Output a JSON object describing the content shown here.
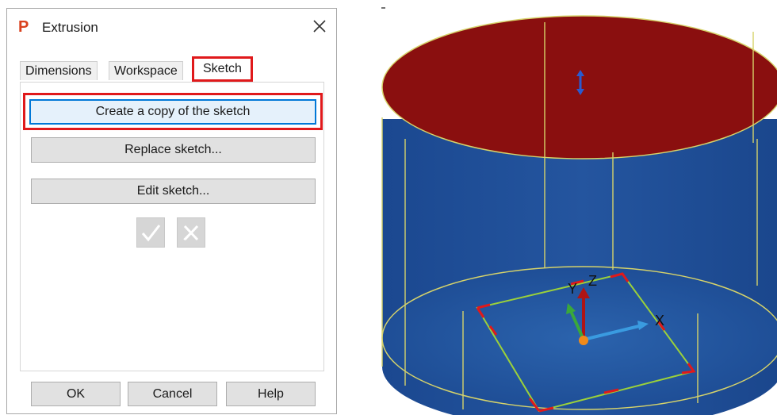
{
  "dialog": {
    "app_icon_letter": "P",
    "title": "Extrusion",
    "tabs": [
      {
        "label": "Dimensions",
        "active": false
      },
      {
        "label": "Workspace",
        "active": false
      },
      {
        "label": "Sketch",
        "active": true
      }
    ],
    "buttons": {
      "create_copy": "Create a copy of the sketch",
      "replace": "Replace sketch...",
      "edit": "Edit sketch...",
      "ok": "OK",
      "cancel": "Cancel",
      "help": "Help"
    }
  },
  "viewport": {
    "axis_labels": {
      "x": "X",
      "y": "Y",
      "z": "Z"
    },
    "colors": {
      "cylinder_side": "#1f4f9b",
      "cylinder_top": "#8c0d0d",
      "edge_lines": "#d6d36a",
      "sketch_frame": "#9bd13a",
      "sketch_corners": "#e0191b",
      "highlight": "#e0191b"
    }
  }
}
